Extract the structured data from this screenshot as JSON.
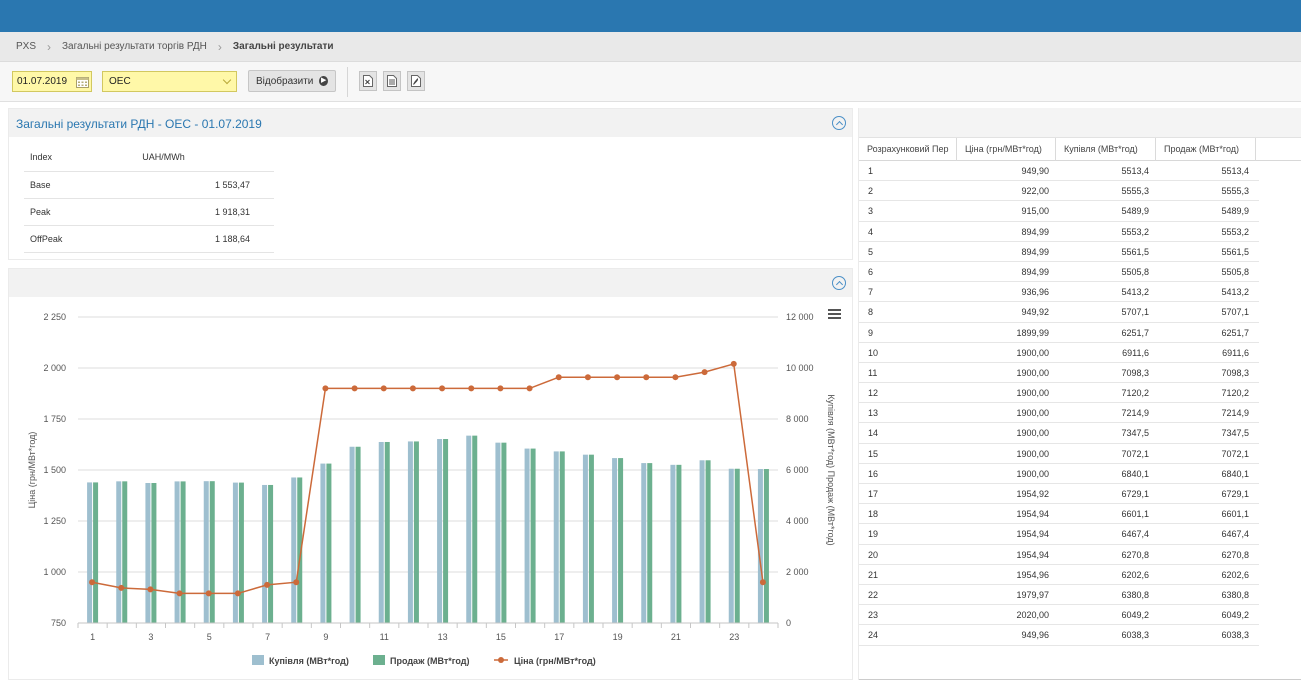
{
  "breadcrumb": {
    "root": "PXS",
    "section": "Загальні результати торгів РДН",
    "current": "Загальні результати"
  },
  "toolbar": {
    "date_value": "01.07.2019",
    "select_value": "ОЕС",
    "show_label": "Відобразити",
    "export_icons": [
      "excel-export-icon",
      "document-export-icon",
      "pdf-export-icon"
    ]
  },
  "summary": {
    "title": "Загальні результати РДН - ОЕС - 01.07.2019",
    "header": {
      "index": "Index",
      "unit": "UAH/MWh"
    },
    "rows": [
      {
        "label": "Base",
        "value": "1 553,47"
      },
      {
        "label": "Peak",
        "value": "1 918,31"
      },
      {
        "label": "OffPeak",
        "value": "1 188,64"
      }
    ]
  },
  "grid": {
    "headers": [
      "Розрахунковий Пер",
      "Ціна (грн/МВт*год)",
      "Купівля (МВт*год)",
      "Продаж (МВт*год)"
    ],
    "rows": [
      [
        "1",
        "949,90",
        "5513,4",
        "5513,4"
      ],
      [
        "2",
        "922,00",
        "5555,3",
        "5555,3"
      ],
      [
        "3",
        "915,00",
        "5489,9",
        "5489,9"
      ],
      [
        "4",
        "894,99",
        "5553,2",
        "5553,2"
      ],
      [
        "5",
        "894,99",
        "5561,5",
        "5561,5"
      ],
      [
        "6",
        "894,99",
        "5505,8",
        "5505,8"
      ],
      [
        "7",
        "936,96",
        "5413,2",
        "5413,2"
      ],
      [
        "8",
        "949,92",
        "5707,1",
        "5707,1"
      ],
      [
        "9",
        "1899,99",
        "6251,7",
        "6251,7"
      ],
      [
        "10",
        "1900,00",
        "6911,6",
        "6911,6"
      ],
      [
        "11",
        "1900,00",
        "7098,3",
        "7098,3"
      ],
      [
        "12",
        "1900,00",
        "7120,2",
        "7120,2"
      ],
      [
        "13",
        "1900,00",
        "7214,9",
        "7214,9"
      ],
      [
        "14",
        "1900,00",
        "7347,5",
        "7347,5"
      ],
      [
        "15",
        "1900,00",
        "7072,1",
        "7072,1"
      ],
      [
        "16",
        "1900,00",
        "6840,1",
        "6840,1"
      ],
      [
        "17",
        "1954,92",
        "6729,1",
        "6729,1"
      ],
      [
        "18",
        "1954,94",
        "6601,1",
        "6601,1"
      ],
      [
        "19",
        "1954,94",
        "6467,4",
        "6467,4"
      ],
      [
        "20",
        "1954,94",
        "6270,8",
        "6270,8"
      ],
      [
        "21",
        "1954,96",
        "6202,6",
        "6202,6"
      ],
      [
        "22",
        "1979,97",
        "6380,8",
        "6380,8"
      ],
      [
        "23",
        "2020,00",
        "6049,2",
        "6049,2"
      ],
      [
        "24",
        "949,96",
        "6038,3",
        "6038,3"
      ]
    ]
  },
  "chart_data": {
    "type": "bar",
    "categories": [
      "1",
      "2",
      "3",
      "4",
      "5",
      "6",
      "7",
      "8",
      "9",
      "10",
      "11",
      "12",
      "13",
      "14",
      "15",
      "16",
      "17",
      "18",
      "19",
      "20",
      "21",
      "22",
      "23",
      "24"
    ],
    "x_tick_labels": [
      "1",
      "3",
      "5",
      "7",
      "9",
      "11",
      "13",
      "15",
      "17",
      "19",
      "21",
      "23"
    ],
    "series": [
      {
        "name": "Купівля (МВт*год)",
        "kind": "bar",
        "axis": "right",
        "color": "#9ebfcf",
        "values": [
          5513.4,
          5555.3,
          5489.9,
          5553.2,
          5561.5,
          5505.8,
          5413.2,
          5707.1,
          6251.7,
          6911.6,
          7098.3,
          7120.2,
          7214.9,
          7347.5,
          7072.1,
          6840.1,
          6729.1,
          6601.1,
          6467.4,
          6270.8,
          6202.6,
          6380.8,
          6049.2,
          6038.3
        ]
      },
      {
        "name": "Продаж (МВт*год)",
        "kind": "bar",
        "axis": "right",
        "color": "#6cb08f",
        "values": [
          5513.4,
          5555.3,
          5489.9,
          5553.2,
          5561.5,
          5505.8,
          5413.2,
          5707.1,
          6251.7,
          6911.6,
          7098.3,
          7120.2,
          7214.9,
          7347.5,
          7072.1,
          6840.1,
          6729.1,
          6601.1,
          6467.4,
          6270.8,
          6202.6,
          6380.8,
          6049.2,
          6038.3
        ]
      },
      {
        "name": "Ціна (грн/МВт*год)",
        "kind": "line",
        "axis": "left",
        "color": "#cc6a3a",
        "values": [
          949.9,
          922.0,
          915.0,
          894.99,
          894.99,
          894.99,
          936.96,
          949.92,
          1899.99,
          1900.0,
          1900.0,
          1900.0,
          1900.0,
          1900.0,
          1900.0,
          1900.0,
          1954.92,
          1954.94,
          1954.94,
          1954.94,
          1954.96,
          1979.97,
          2020.0,
          949.96
        ]
      }
    ],
    "y_left": {
      "label": "Ціна (грн/МВт*год)",
      "ylim": [
        750,
        2250
      ],
      "ticks": [
        "750",
        "1 000",
        "1 250",
        "1 500",
        "1 750",
        "2 000",
        "2 250"
      ],
      "tick_values": [
        750,
        1000,
        1250,
        1500,
        1750,
        2000,
        2250
      ]
    },
    "y_right": {
      "label": "Купівля (МВт*год) Продаж (МВт*год)",
      "ylim": [
        0,
        12000
      ],
      "ticks": [
        "0",
        "2 000",
        "4 000",
        "6 000",
        "8 000",
        "10 000",
        "12 000"
      ],
      "tick_values": [
        0,
        2000,
        4000,
        6000,
        8000,
        10000,
        12000
      ]
    },
    "grid": true,
    "legend": "bottom",
    "menu_icon": "hamburger-menu-icon"
  }
}
